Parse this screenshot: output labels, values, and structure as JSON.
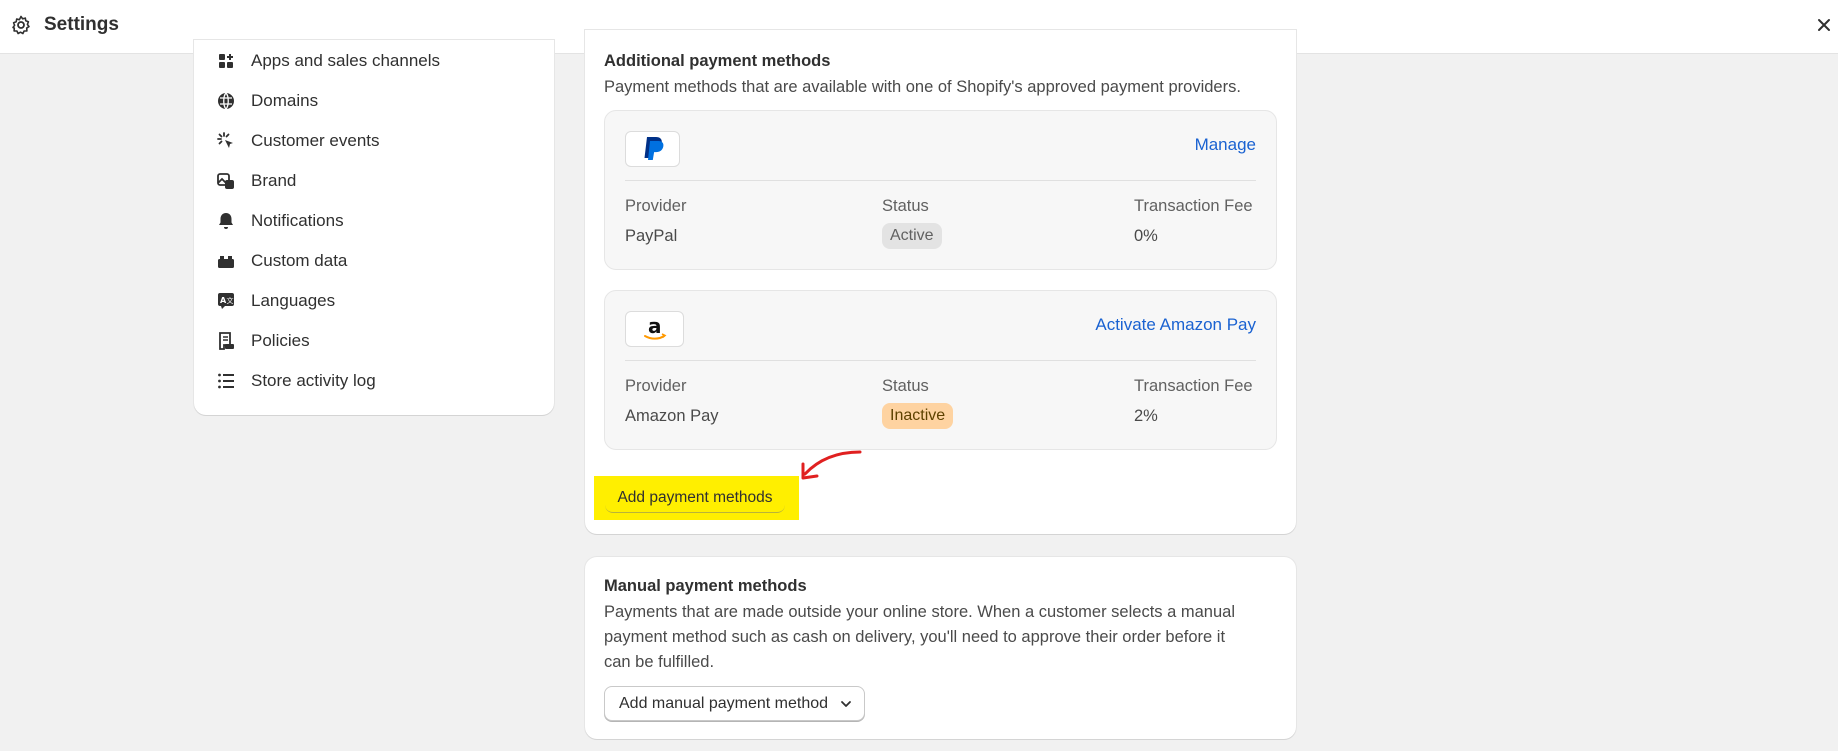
{
  "header": {
    "title": "Settings",
    "icon": "gear-icon",
    "close_icon": "close-icon"
  },
  "sidebar": {
    "items": [
      {
        "label": "Apps and sales channels",
        "icon": "apps-icon"
      },
      {
        "label": "Domains",
        "icon": "globe-icon"
      },
      {
        "label": "Customer events",
        "icon": "cursor-click-icon"
      },
      {
        "label": "Brand",
        "icon": "brand-icon"
      },
      {
        "label": "Notifications",
        "icon": "bell-icon"
      },
      {
        "label": "Custom data",
        "icon": "blocks-icon"
      },
      {
        "label": "Languages",
        "icon": "language-icon"
      },
      {
        "label": "Policies",
        "icon": "policy-icon"
      },
      {
        "label": "Store activity log",
        "icon": "list-icon"
      }
    ]
  },
  "additional": {
    "title": "Additional payment methods",
    "subtitle": "Payment methods that are available with one of Shopify's approved payment providers.",
    "providers": [
      {
        "logo": "paypal-logo",
        "action": "Manage",
        "provider_header": "Provider",
        "status_header": "Status",
        "fee_header": "Transaction Fee",
        "provider": "PayPal",
        "status": "Active",
        "fee": "0%"
      },
      {
        "logo": "amazon-logo",
        "action": "Activate Amazon Pay",
        "provider_header": "Provider",
        "status_header": "Status",
        "fee_header": "Transaction Fee",
        "provider": "Amazon Pay",
        "status": "Inactive",
        "fee": "2%"
      }
    ],
    "add_button": "Add payment methods"
  },
  "manual": {
    "title": "Manual payment methods",
    "subtitle_line1": "Payments that are made outside your online store. When a customer selects a manual",
    "subtitle_line2": "payment method such as cash on delivery, you'll need to approve their order before it",
    "subtitle_line3": "can be fulfilled.",
    "dropdown_label": "Add manual payment method"
  },
  "colors": {
    "link": "#1a62d1",
    "highlight": "#ffef00",
    "arrow": "#e02020",
    "inactive_badge": "#fed3a1"
  }
}
